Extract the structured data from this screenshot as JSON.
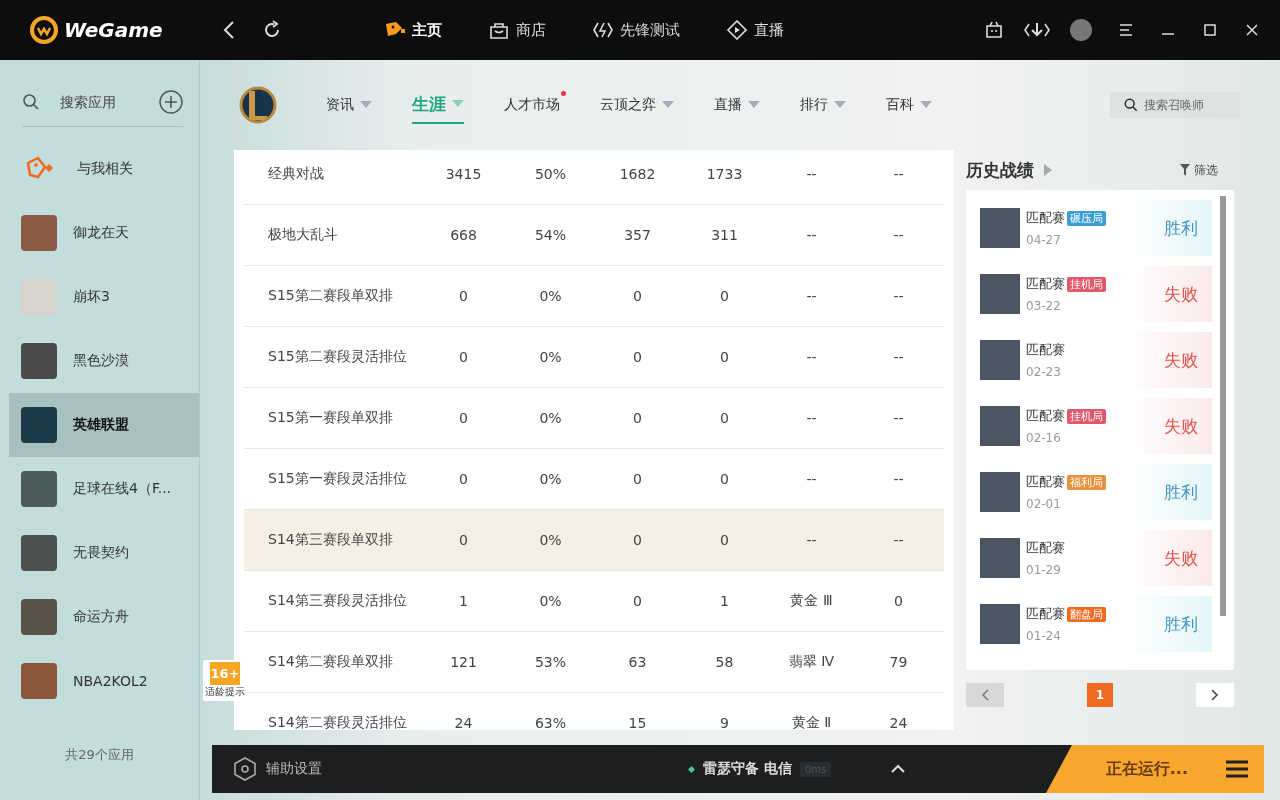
{
  "app": {
    "logo_text": "WeGame"
  },
  "top_nav": [
    {
      "label": "主页",
      "selected": true
    },
    {
      "label": "商店",
      "selected": false
    },
    {
      "label": "先锋测试",
      "selected": false
    },
    {
      "label": "直播",
      "selected": false
    }
  ],
  "sidebar": {
    "search_placeholder": "搜索应用",
    "footer": "共29个应用",
    "items": [
      {
        "label": "与我相关",
        "kind": "feed",
        "selected": false
      },
      {
        "label": "御龙在天",
        "kind": "game",
        "color": "#8a5a44",
        "selected": false
      },
      {
        "label": "崩坏3",
        "kind": "game",
        "color": "#d8d2cc",
        "selected": false
      },
      {
        "label": "黑色沙漠",
        "kind": "game",
        "color": "#4a4a4a",
        "selected": false
      },
      {
        "label": "英雄联盟",
        "kind": "game",
        "color": "#1d3a4a",
        "selected": true
      },
      {
        "label": "足球在线4（F...",
        "kind": "game",
        "color": "#4b5a5a",
        "selected": false
      },
      {
        "label": "无畏契约",
        "kind": "game",
        "color": "#4d5050",
        "selected": false
      },
      {
        "label": "命运方舟",
        "kind": "game",
        "color": "#5a5248",
        "selected": false
      },
      {
        "label": "NBA2KOL2",
        "kind": "game",
        "color": "#8a5838",
        "selected": false
      }
    ]
  },
  "sub_nav": [
    {
      "label": "资讯",
      "dropdown": true,
      "dot": false,
      "selected": false
    },
    {
      "label": "生涯",
      "dropdown": true,
      "dot": false,
      "selected": true
    },
    {
      "label": "人才市场",
      "dropdown": false,
      "dot": true,
      "selected": false
    },
    {
      "label": "云顶之弈",
      "dropdown": true,
      "dot": false,
      "selected": false
    },
    {
      "label": "直播",
      "dropdown": true,
      "dot": false,
      "selected": false
    },
    {
      "label": "排行",
      "dropdown": true,
      "dot": false,
      "selected": false
    },
    {
      "label": "百科",
      "dropdown": true,
      "dot": false,
      "selected": false
    }
  ],
  "summoner_search": {
    "placeholder": "搜索召唤师"
  },
  "table": {
    "rows": [
      {
        "selected": false,
        "cells": [
          "经典对战",
          "3415",
          "50%",
          "1682",
          "1733",
          "--",
          "--"
        ]
      },
      {
        "selected": false,
        "cells": [
          "极地大乱斗",
          "668",
          "54%",
          "357",
          "311",
          "--",
          "--"
        ]
      },
      {
        "selected": false,
        "cells": [
          "S15第二赛段单双排",
          "0",
          "0%",
          "0",
          "0",
          "--",
          "--"
        ]
      },
      {
        "selected": false,
        "cells": [
          "S15第二赛段灵活排位",
          "0",
          "0%",
          "0",
          "0",
          "--",
          "--"
        ]
      },
      {
        "selected": false,
        "cells": [
          "S15第一赛段单双排",
          "0",
          "0%",
          "0",
          "0",
          "--",
          "--"
        ]
      },
      {
        "selected": false,
        "cells": [
          "S15第一赛段灵活排位",
          "0",
          "0%",
          "0",
          "0",
          "--",
          "--"
        ]
      },
      {
        "selected": true,
        "cells": [
          "S14第三赛段单双排",
          "0",
          "0%",
          "0",
          "0",
          "--",
          "--"
        ]
      },
      {
        "selected": false,
        "cells": [
          "S14第三赛段灵活排位",
          "1",
          "0%",
          "0",
          "1",
          "黄金 Ⅲ",
          "0"
        ]
      },
      {
        "selected": false,
        "cells": [
          "S14第二赛段单双排",
          "121",
          "53%",
          "63",
          "58",
          "翡翠 Ⅳ",
          "79"
        ]
      },
      {
        "selected": false,
        "cells": [
          "S14第二赛段灵活排位",
          "24",
          "63%",
          "15",
          "9",
          "黄金 Ⅱ",
          "24"
        ]
      }
    ]
  },
  "age_badge": {
    "rating": "16+",
    "label": "适龄提示"
  },
  "history": {
    "title": "历史战绩",
    "filter": "筛选",
    "matches": [
      {
        "mode": "匹配赛",
        "tag": "碾压局",
        "color": "#3b9fd6",
        "date": "04-27",
        "result": "胜利",
        "kind": "win"
      },
      {
        "mode": "匹配赛",
        "tag": "挂机局",
        "color": "#e0586a",
        "date": "03-22",
        "result": "失败",
        "kind": "loss"
      },
      {
        "mode": "匹配赛",
        "date": "02-23",
        "result": "失败",
        "kind": "loss"
      },
      {
        "mode": "匹配赛",
        "tag": "挂机局",
        "color": "#e0586a",
        "date": "02-16",
        "result": "失败",
        "kind": "loss"
      },
      {
        "mode": "匹配赛",
        "tag": "福利局",
        "color": "#e8913a",
        "date": "02-01",
        "result": "胜利",
        "kind": "win"
      },
      {
        "mode": "匹配赛",
        "date": "01-29",
        "result": "失败",
        "kind": "loss"
      },
      {
        "mode": "匹配赛",
        "tag": "翻盘局",
        "color": "#f06a22",
        "date": "01-24",
        "result": "胜利",
        "kind": "win"
      }
    ],
    "pages": [
      {
        "label": "1",
        "selected": true
      }
    ]
  },
  "bottom_bar": {
    "assist": "辅助设置",
    "server": "雷瑟守备 电信",
    "ping": "0ms",
    "running": "正在运行..."
  }
}
